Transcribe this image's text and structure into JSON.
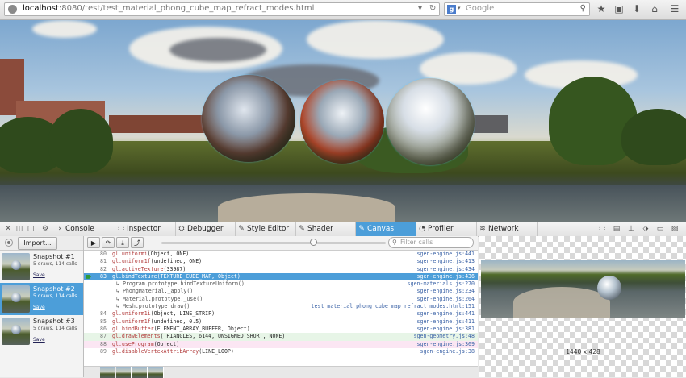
{
  "browser": {
    "url_host": "localhost",
    "url_rest": ":8080/test/test_material_phong_cube_map_refract_modes.html",
    "search_placeholder": "Google",
    "icons": [
      "globe-icon",
      "dropdown-arrow-icon",
      "reload-icon",
      "google-icon",
      "search-icon",
      "bookmark-star-icon",
      "reading-list-icon",
      "download-icon",
      "home-icon",
      "menu-icon"
    ]
  },
  "devtools": {
    "tabs": [
      {
        "label": "Console",
        "icon": "console-icon"
      },
      {
        "label": "Inspector",
        "icon": "inspector-icon"
      },
      {
        "label": "Debugger",
        "icon": "debugger-icon"
      },
      {
        "label": "Style Editor",
        "icon": "style-editor-icon"
      },
      {
        "label": "Shader Editor",
        "icon": "shader-editor-icon"
      },
      {
        "label": "Canvas",
        "icon": "canvas-icon"
      },
      {
        "label": "Profiler",
        "icon": "profiler-icon"
      },
      {
        "label": "Network",
        "icon": "network-icon"
      }
    ],
    "active_tab": "Canvas"
  },
  "sidebar": {
    "import_label": "Import...",
    "snapshots": [
      {
        "title": "Snapshot #1",
        "detail": "5 draws, 114 calls",
        "save": "Save"
      },
      {
        "title": "Snapshot #2",
        "detail": "5 draws, 114 calls",
        "save": "Save"
      },
      {
        "title": "Snapshot #3",
        "detail": "5 draws, 114 calls",
        "save": "Save"
      }
    ]
  },
  "calls": {
    "filter_placeholder": "Filter calls",
    "rows": [
      {
        "ln": "80",
        "fn": "gl.uniformi",
        "args": "(Object, ONE)",
        "src": "sgen-engine.js:441",
        "type": "call"
      },
      {
        "ln": "81",
        "fn": "gl.uniform1f",
        "args": "(undefined, ONE)",
        "src": "sgen-engine.js:413",
        "type": "call"
      },
      {
        "ln": "82",
        "fn": "gl.activeTexture",
        "args": "(33987)",
        "src": "sgen-engine.js:434",
        "type": "call"
      },
      {
        "ln": "83",
        "fn": "gl.bindTexture",
        "args": "(TEXTURE_CUBE_MAP, Object)",
        "src": "sgen-engine.js:436",
        "type": "hl"
      },
      {
        "ln": "",
        "fn": "",
        "args": "↳ Program.prototype.bindTextureUniform()",
        "src": "sgen-materials.js:270",
        "type": "sub"
      },
      {
        "ln": "",
        "fn": "",
        "args": "  ↳ PhongMaterial._apply()",
        "src": "sgen-engine.js:234",
        "type": "sub"
      },
      {
        "ln": "",
        "fn": "",
        "args": "    ↳ Material.prototype._use()",
        "src": "sgen-engine.js:264",
        "type": "sub"
      },
      {
        "ln": "",
        "fn": "",
        "args": "      ↳ Mesh.prototype.draw()",
        "src": "test_material_phong_cube_map_refract_modes.html:151",
        "type": "sub"
      },
      {
        "ln": "84",
        "fn": "gl.uniform1i",
        "args": "(Object, LINE_STRIP)",
        "src": "sgen-engine.js:441",
        "type": "call"
      },
      {
        "ln": "85",
        "fn": "gl.uniform1f",
        "args": "(undefined, 0.5)",
        "src": "sgen-engine.js:411",
        "type": "call"
      },
      {
        "ln": "86",
        "fn": "gl.bindBuffer",
        "args": "(ELEMENT_ARRAY_BUFFER, Object)",
        "src": "sgen-engine.js:381",
        "type": "call"
      },
      {
        "ln": "87",
        "fn": "gl.drawElements",
        "args": "(TRIANGLES, 6144, UNSIGNED_SHORT, NONE)",
        "src": "sgen-geometry.js:48",
        "type": "draw"
      },
      {
        "ln": "88",
        "fn": "gl.useProgram",
        "args": "(Object)",
        "src": "sgen-engine.js:369",
        "type": "prog"
      },
      {
        "ln": "89",
        "fn": "gl.disableVertexAttribArray",
        "args": "(LINE_LOOP)",
        "src": "sgen-engine.js:38",
        "type": "call"
      }
    ]
  },
  "preview": {
    "dimensions": "1440 x 428"
  }
}
